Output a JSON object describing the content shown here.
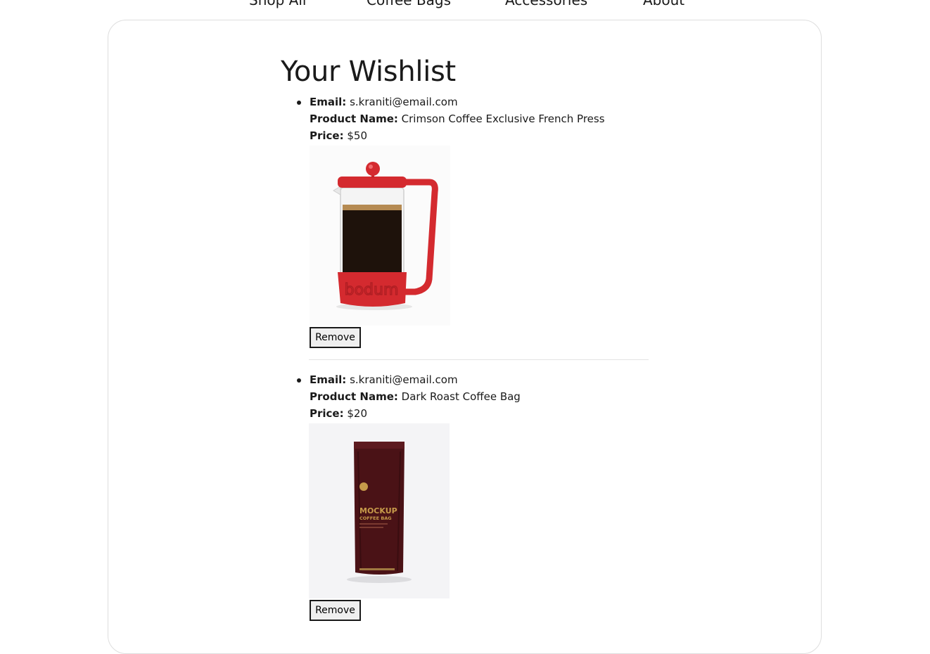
{
  "nav": {
    "items": [
      "Shop All",
      "Coffee Bags",
      "Accessories",
      "About"
    ]
  },
  "page_title": "Your Wishlist",
  "labels": {
    "email": "Email:",
    "product_name": "Product Name:",
    "price": "Price:"
  },
  "wishlist": [
    {
      "email": "s.kraniti@email.com",
      "product_name": "Crimson Coffee Exclusive French Press",
      "price": "$50",
      "image": "french-press-image",
      "image_text": "bodum",
      "remove_label": "Remove"
    },
    {
      "email": "s.kraniti@email.com",
      "product_name": "Dark Roast Coffee Bag",
      "price": "$20",
      "image": "coffee-bag-image",
      "image_text": [
        "MOCKUP",
        "COFFEE BAG"
      ],
      "remove_label": "Remove"
    }
  ],
  "colors": {
    "press_red": "#d42a2f",
    "bag_brown": "#4a1216",
    "bag_gold": "#c69a4a"
  }
}
